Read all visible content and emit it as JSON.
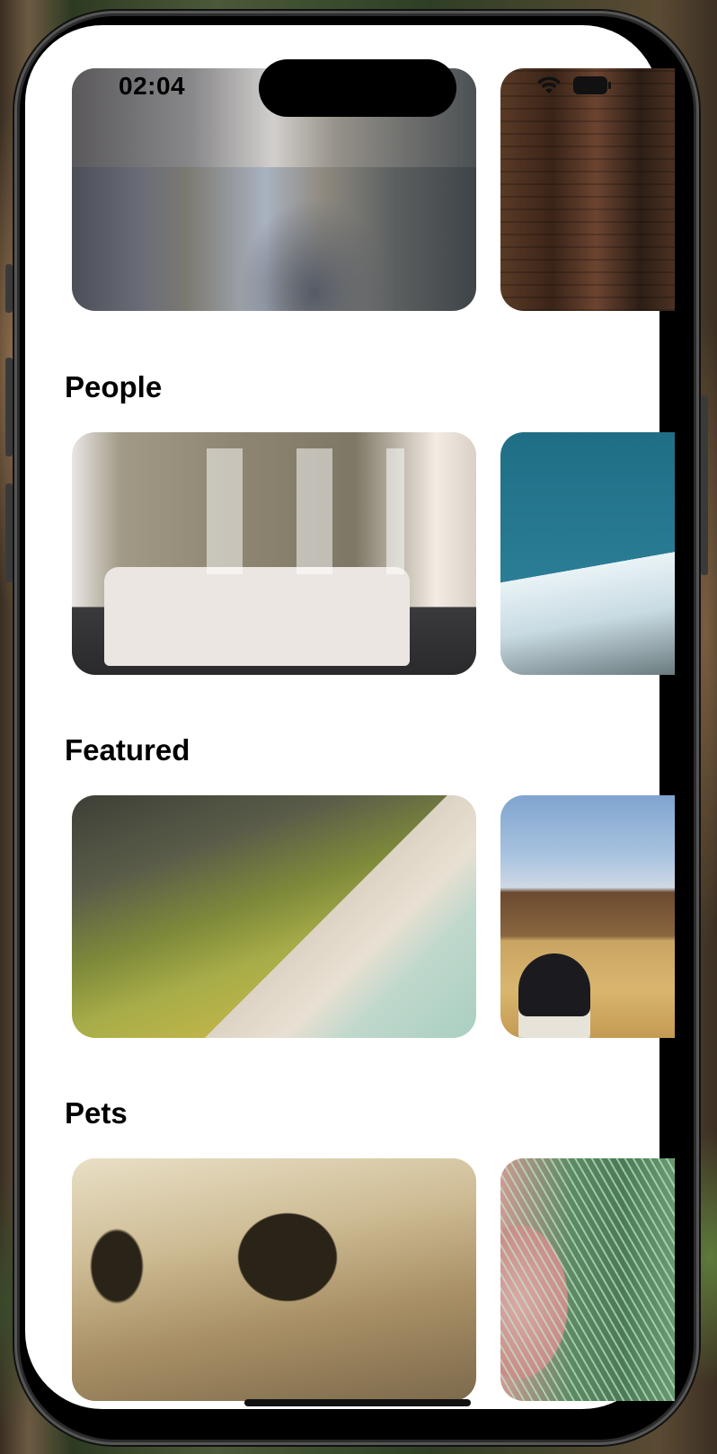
{
  "status_bar": {
    "time": "02:04"
  },
  "sections": [
    {
      "title": "",
      "images": [
        "street-traffic-photo",
        "brick-building-photo"
      ]
    },
    {
      "title": "People",
      "images": [
        "white-jeep-photo",
        "snowy-mountain-photo"
      ]
    },
    {
      "title": "Featured",
      "images": [
        "coastal-cliff-beach-photo",
        "field-sneaker-photo"
      ]
    },
    {
      "title": "Pets",
      "images": [
        "sepia-tree-hill-photo",
        "pine-needles-hand-photo"
      ]
    }
  ],
  "icons": {
    "wifi": "wifi-icon",
    "battery": "battery-icon"
  },
  "colors": {
    "screen_background": "#ffffff",
    "title_text": "#000000"
  }
}
